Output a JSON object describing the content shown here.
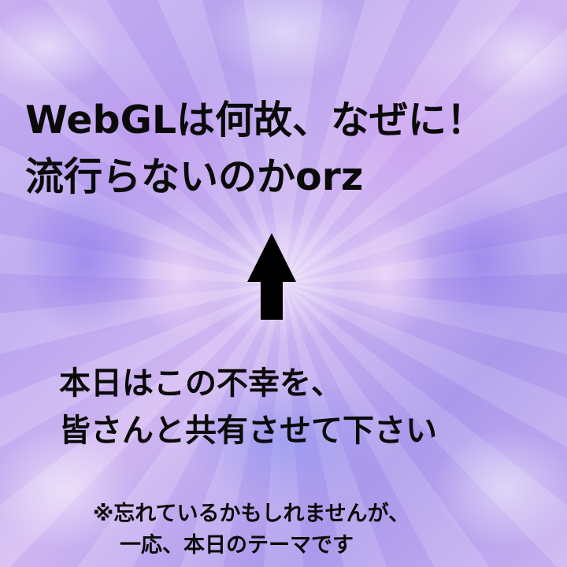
{
  "headline": {
    "line1": "WebGLは何故、なぜに！",
    "line2": "流行らないのかorz"
  },
  "arrow": {
    "icon": "up-arrow-icon",
    "color": "#000000"
  },
  "message": {
    "line1": "本日はこの不幸を、",
    "line2": "皆さんと共有させて下さい"
  },
  "note": {
    "line1": "※忘れているかもしれませんが、",
    "line2": "一応、本日のテーマです"
  },
  "colors": {
    "background_base": "#c7b2f1",
    "text": "#0a0a0a"
  }
}
